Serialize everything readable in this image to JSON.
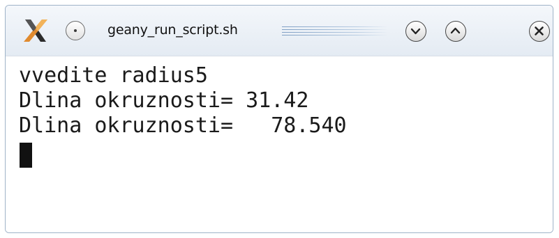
{
  "window": {
    "title": "geany_run_script.sh"
  },
  "terminal": {
    "lines": [
      "vvedite radius5",
      "Dlina okruznosti= 31.42",
      "Dlina okruznosti=   78.540"
    ]
  },
  "icons": {
    "app": "geany-x-icon",
    "sticky": "sticky-dot-icon",
    "minimize": "chevron-down-icon",
    "maximize": "chevron-up-icon",
    "close": "close-x-icon"
  }
}
